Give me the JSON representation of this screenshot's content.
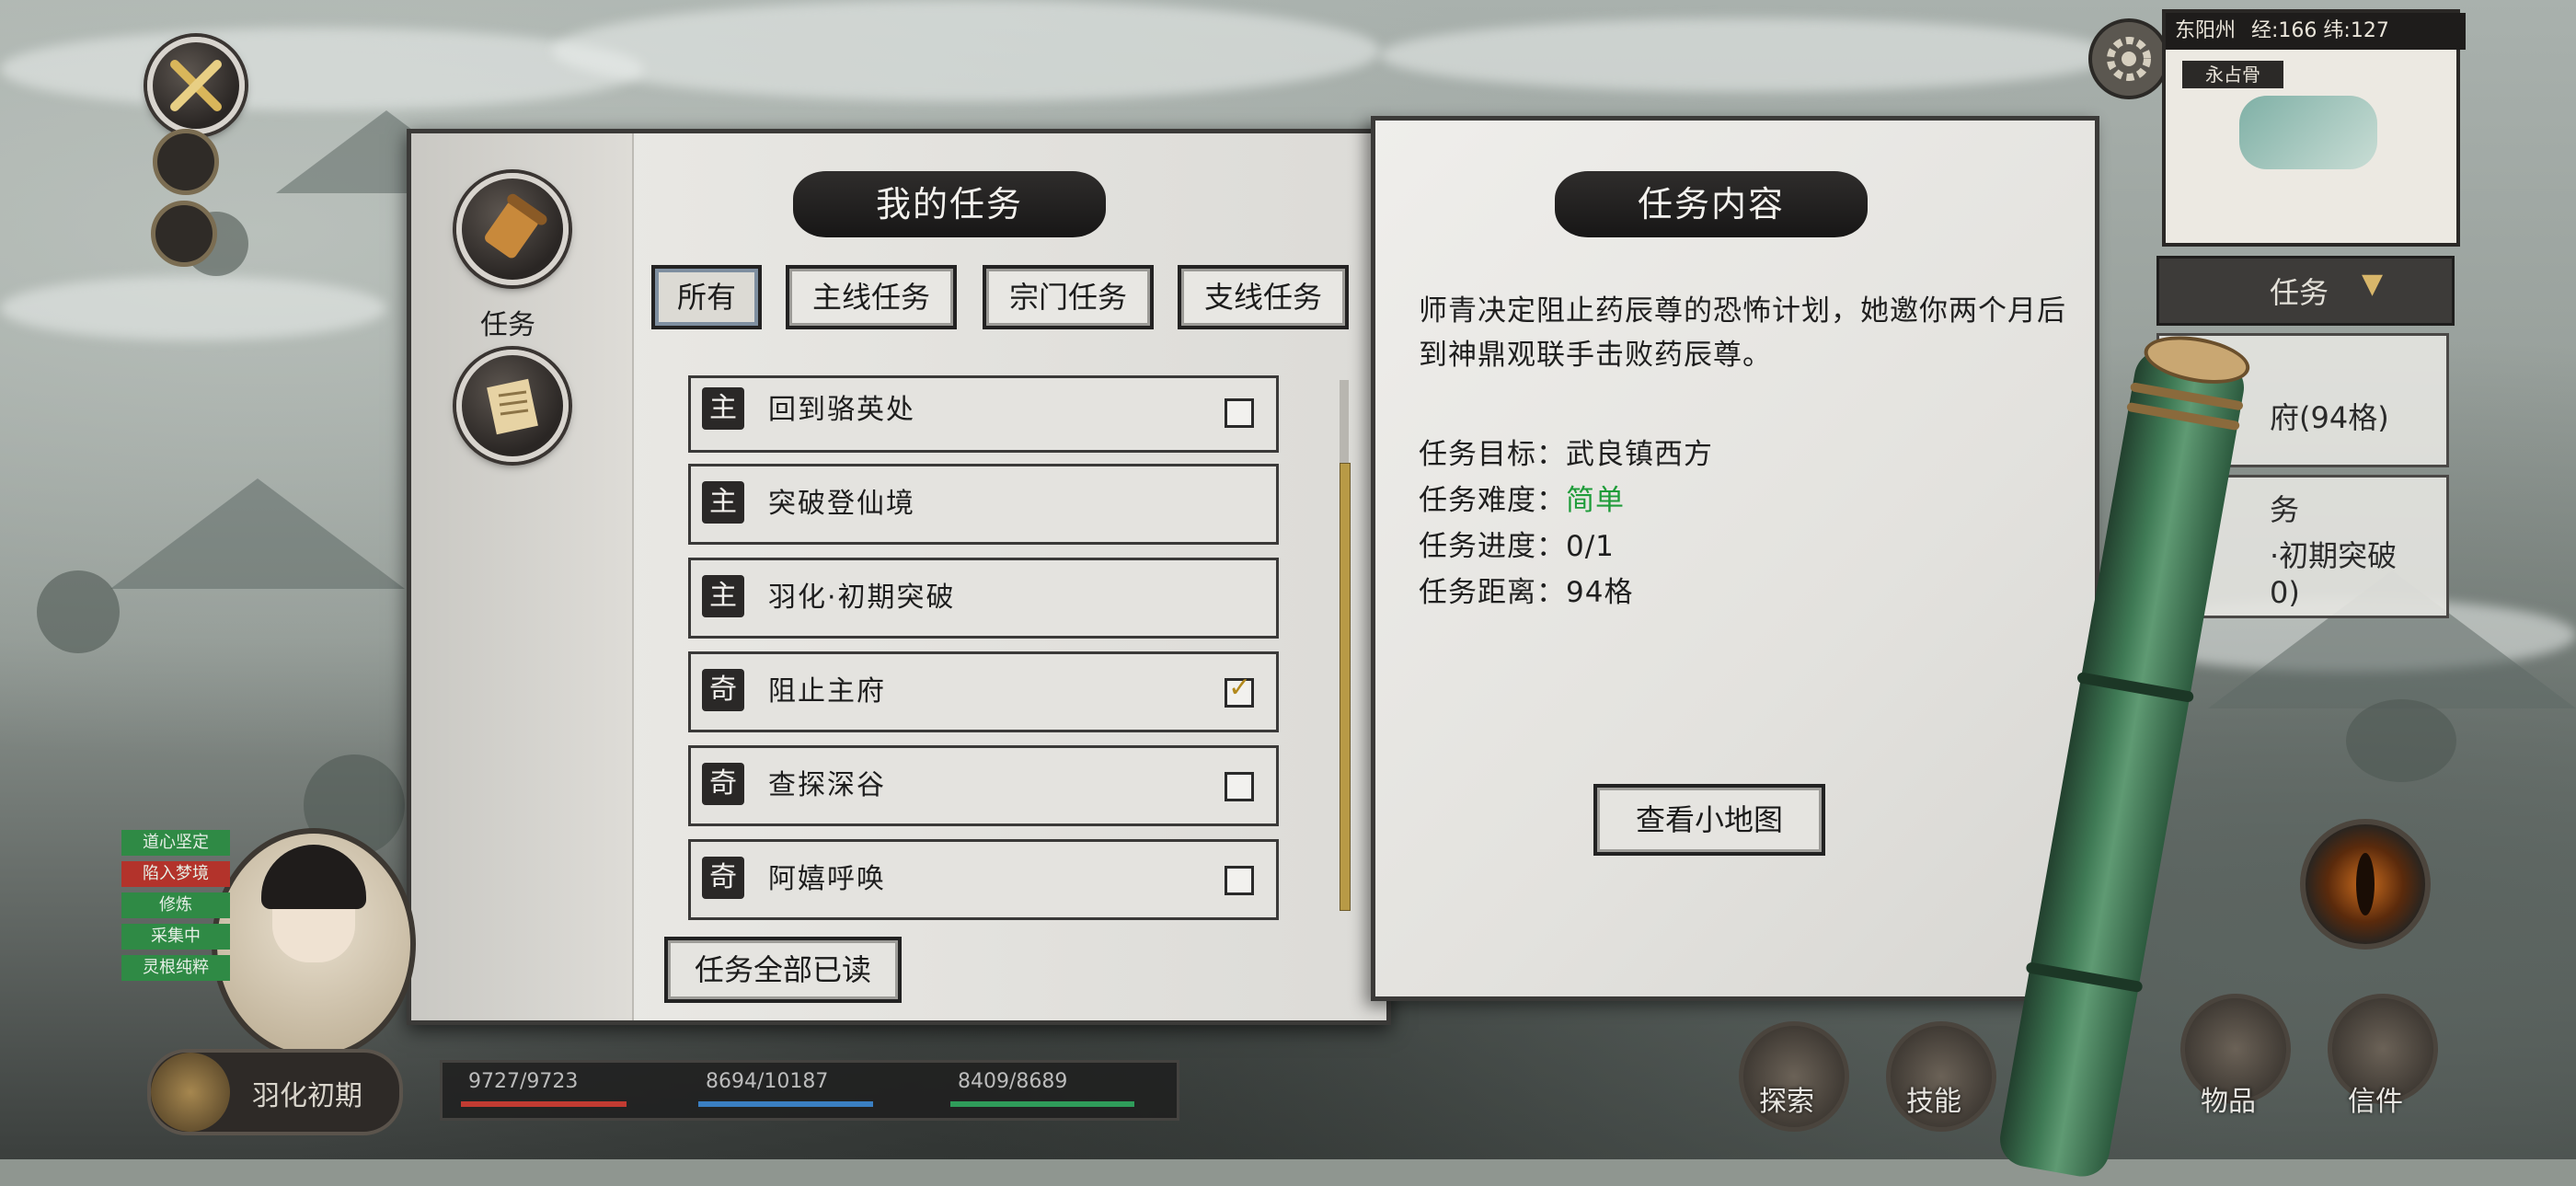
{
  "colors": {
    "easy_green": "#1f9c3a",
    "ink": "#1c1c1c",
    "paper": "#e8e7e3",
    "scroll_gold": "#b89a46",
    "hp_red": "#c23b32",
    "mp_blue": "#3a7fc2",
    "stamina_green": "#2f9c5a"
  },
  "top_left": {
    "close_icon": "crossed-swords-icon"
  },
  "sidebar": {
    "task_label": "任务",
    "task_icon": "scroll-icon",
    "letter_icon": "letter-icon"
  },
  "left_page": {
    "title": "我的任务",
    "tabs": [
      {
        "label": "所有",
        "active": true
      },
      {
        "label": "主线任务",
        "active": false
      },
      {
        "label": "宗门任务",
        "active": false
      },
      {
        "label": "支线任务",
        "active": false
      }
    ],
    "quests": [
      {
        "type": "主",
        "name": "回到骆英处",
        "tracked": false
      },
      {
        "type": "主",
        "name": "突破登仙境",
        "tracked": false
      },
      {
        "type": "主",
        "name": "羽化·初期突破",
        "tracked": false
      },
      {
        "type": "奇",
        "name": "阻止主府",
        "tracked": true
      },
      {
        "type": "奇",
        "name": "查探深谷",
        "tracked": false
      },
      {
        "type": "奇",
        "name": "阿嬉呼唤",
        "tracked": false
      }
    ],
    "mark_all_read": "任务全部已读"
  },
  "right_page": {
    "title": "任务内容",
    "description": "师青决定阻止药辰尊的恐怖计划，她邀你两个月后到神鼎观联手击败药辰尊。",
    "target_label": "任务目标：",
    "target_value": "武良镇西方",
    "difficulty_label": "任务难度：",
    "difficulty_value": "简单",
    "progress_label": "任务进度：",
    "progress_value": "0/1",
    "distance_label": "任务距离：",
    "distance_value": "94格",
    "view_map_button": "查看小地图"
  },
  "hud_right": {
    "location": "东阳州",
    "coords": "经:166 纬:127",
    "minimap_title": "永占骨",
    "task_dropdown": "任务",
    "quest_hint_1": "府(94格)",
    "quest_hint_2_title": "务",
    "quest_hint_2": "·初期突破",
    "quest_hint_2_sub": "0)",
    "settings_icon": "gear-icon",
    "eye_icon": "eye-icon"
  },
  "hud_bottom": {
    "realm_button": "羽化初期",
    "hp": "9727/9723",
    "mp": "8694/10187",
    "stamina": "8409/8689",
    "tags": [
      "道心坚定",
      "陷入梦境",
      "修炼",
      "采集中",
      "灵根纯粹"
    ],
    "menu": [
      {
        "label": "探索",
        "icon": "explore-icon"
      },
      {
        "label": "技能",
        "icon": "yin-yang-icon"
      },
      {
        "label": "物品",
        "icon": "bag-icon"
      },
      {
        "label": "信件",
        "icon": "letter-icon"
      }
    ]
  }
}
